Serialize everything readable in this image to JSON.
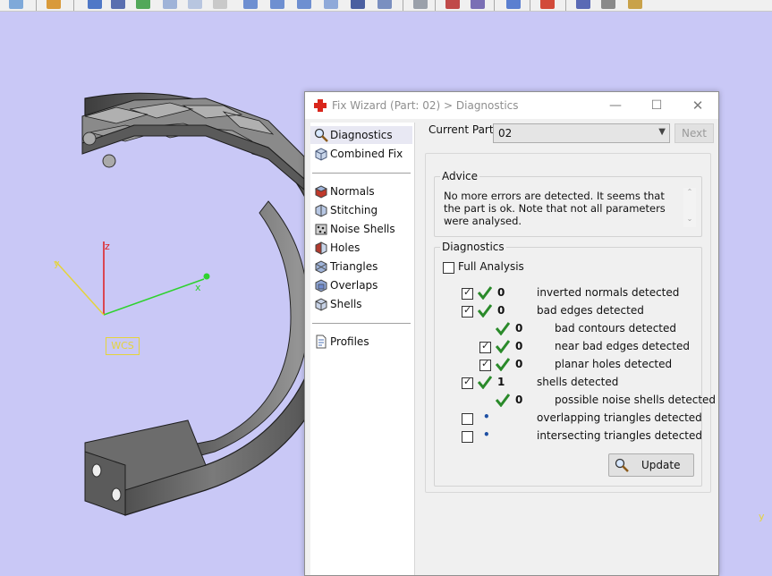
{
  "viewport": {
    "wcs_label": "WCS",
    "axis_z": "z",
    "axis_y": "y",
    "axis_x": "x",
    "background_color": "#c9c8f6"
  },
  "dialog": {
    "title": "Fix Wizard (Part: 02) > Diagnostics",
    "window_buttons": {
      "minimize": "—",
      "maximize": "☐",
      "close": "✕"
    },
    "nav": {
      "top_items": [
        {
          "label": "Diagnostics",
          "icon": "magnifier-icon"
        },
        {
          "label": "Combined Fix",
          "icon": "cube-icon"
        }
      ],
      "fix_items": [
        {
          "label": "Normals",
          "icon": "normals-icon"
        },
        {
          "label": "Stitching",
          "icon": "stitching-icon"
        },
        {
          "label": "Noise Shells",
          "icon": "noise-shells-icon"
        },
        {
          "label": "Holes",
          "icon": "holes-icon"
        },
        {
          "label": "Triangles",
          "icon": "triangles-icon"
        },
        {
          "label": "Overlaps",
          "icon": "overlaps-icon"
        },
        {
          "label": "Shells",
          "icon": "shells-icon"
        }
      ],
      "bottom_items": [
        {
          "label": "Profiles",
          "icon": "profiles-icon"
        }
      ]
    },
    "current_part_label": "Current Part:",
    "current_part_value": "02",
    "next_button": "Next",
    "advice": {
      "title": "Advice",
      "text": "No more errors are detected. It seems that the part is ok. Note that not all parameters were analysed."
    },
    "diagnostics": {
      "title": "Diagnostics",
      "full_analysis_label": "Full Analysis",
      "full_analysis_checked": false,
      "rows": [
        {
          "checked": true,
          "status": "ok",
          "count": "0",
          "text": "inverted normals detected",
          "indent": 0
        },
        {
          "checked": true,
          "status": "ok",
          "count": "0",
          "text": "bad edges detected",
          "indent": 0
        },
        {
          "checked": null,
          "status": "ok",
          "count": "0",
          "text": "bad contours detected",
          "indent": 1
        },
        {
          "checked": true,
          "status": "ok",
          "count": "0",
          "text": "near bad edges detected",
          "indent": 1
        },
        {
          "checked": true,
          "status": "ok",
          "count": "0",
          "text": "planar holes detected",
          "indent": 1
        },
        {
          "checked": true,
          "status": "ok",
          "count": "1",
          "text": "shells detected",
          "indent": 0
        },
        {
          "checked": null,
          "status": "ok",
          "count": "0",
          "text": "possible noise shells detected",
          "indent": 1
        },
        {
          "checked": false,
          "status": "pending",
          "count": "•",
          "text": "overlapping triangles detected",
          "indent": 0
        },
        {
          "checked": false,
          "status": "pending",
          "count": "•",
          "text": "intersecting triangles detected",
          "indent": 0
        }
      ],
      "update_button": "Update"
    }
  }
}
